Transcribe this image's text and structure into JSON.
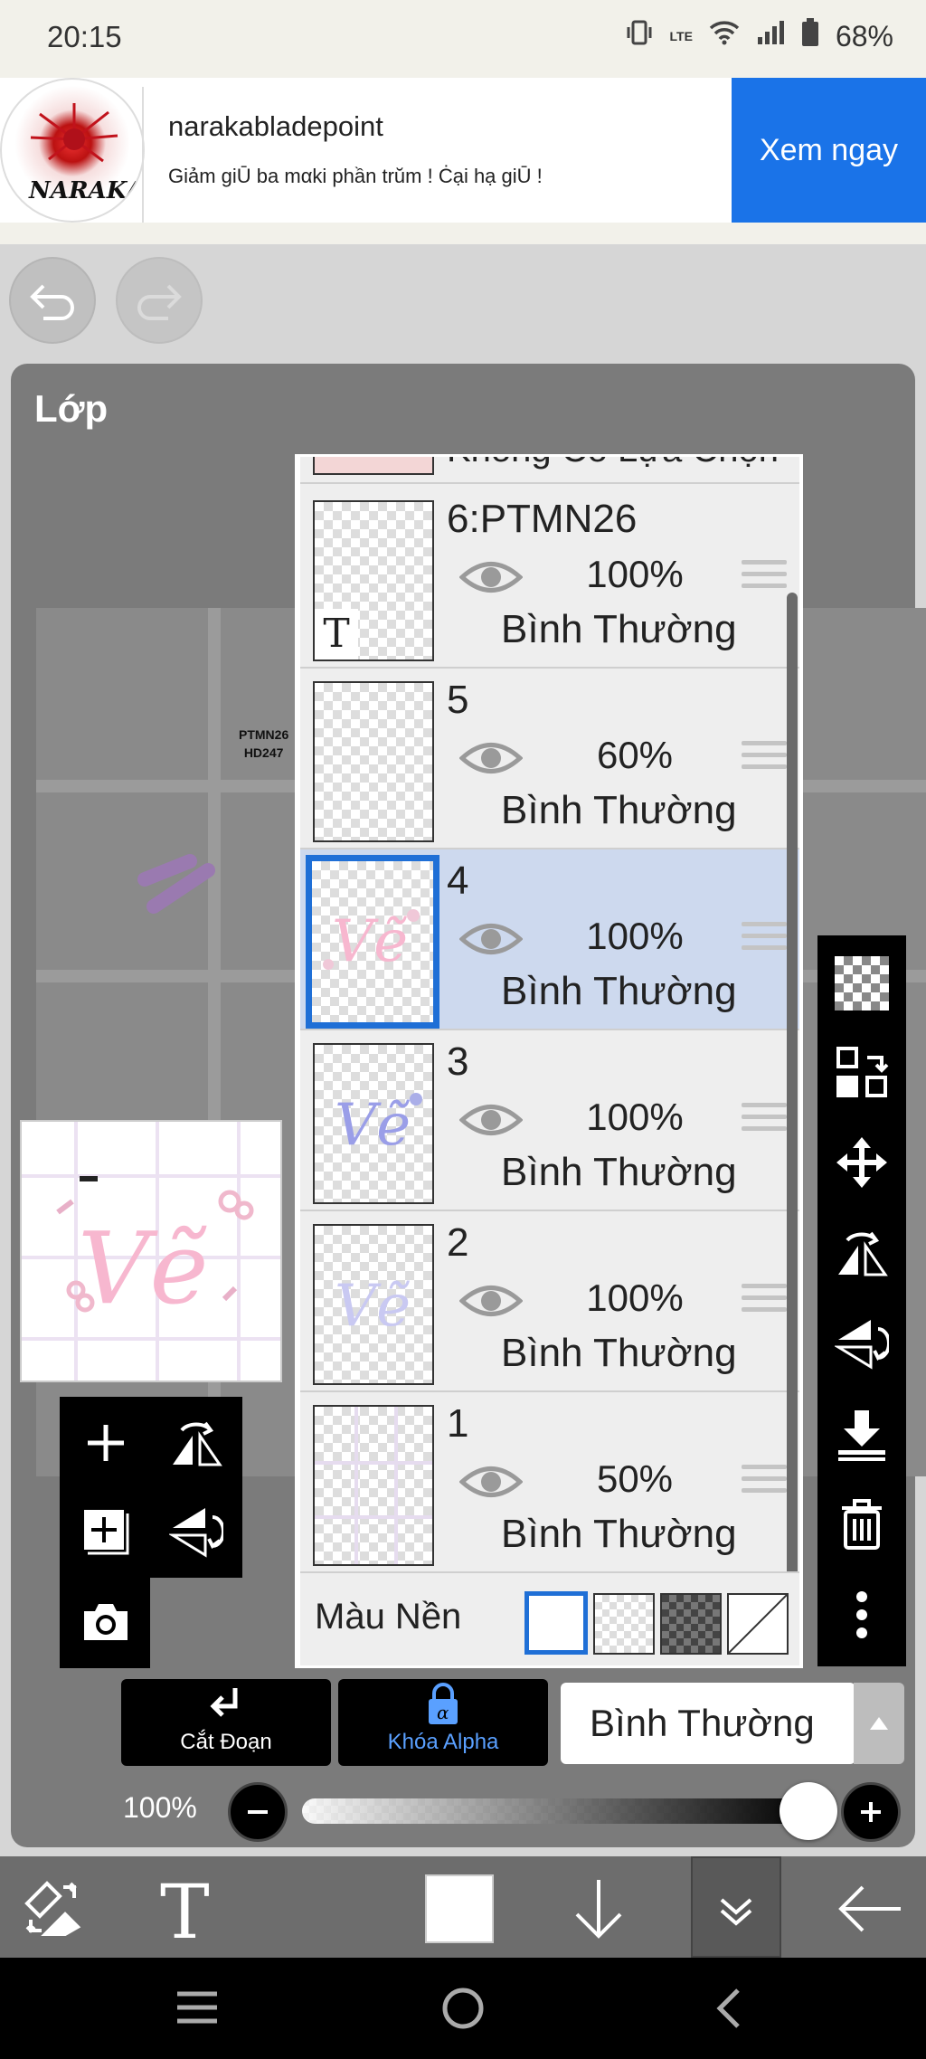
{
  "status_bar": {
    "time": "20:15",
    "network": "LTE",
    "battery": "68%"
  },
  "ad": {
    "logo_text": "NARAKA",
    "name": "narakabladepoint",
    "description": "Giảm giŪ ba mαki phần trŭm ! Ċại hạ giŪ !",
    "cta": "Xem ngay"
  },
  "panel": {
    "title": "Lớp"
  },
  "canvas": {
    "stamp_line1": "PTMN26",
    "stamp_line2": "HD247"
  },
  "layers": {
    "top_partial": "Không Có Lựa Chọn",
    "items": [
      {
        "name": "6:PTMN26",
        "opacity": "100%",
        "blend": "Bình Thường",
        "thumb_mark": "T"
      },
      {
        "name": "5",
        "opacity": "60%",
        "blend": "Bình Thường"
      },
      {
        "name": "4",
        "opacity": "100%",
        "blend": "Bình Thường",
        "selected": true
      },
      {
        "name": "3",
        "opacity": "100%",
        "blend": "Bình Thường"
      },
      {
        "name": "2",
        "opacity": "100%",
        "blend": "Bình Thường"
      },
      {
        "name": "1",
        "opacity": "50%",
        "blend": "Bình Thường"
      }
    ],
    "background_label": "Màu Nền"
  },
  "actions": {
    "cut_label": "Cắt Đoạn",
    "alpha_label": "Khóa Alpha",
    "blend_mode": "Bình Thường"
  },
  "opacity_control": {
    "label": "100%",
    "value": 1.0
  },
  "colors": {
    "accent": "#1f6fd6",
    "ad_button": "#1a73e8",
    "selected_row": "#cdd9ee",
    "alpha_text": "#5aa0ff"
  },
  "icons": {
    "right_toolbar": [
      "transparency-icon",
      "layer-swap-icon",
      "move-icon",
      "flip-horizontal-icon",
      "flip-vertical-icon",
      "merge-down-icon",
      "trash-icon",
      "more-icon"
    ],
    "bottom_toolbar": [
      "transform-icon",
      "text-tool-icon",
      "color-swatch-icon",
      "arrow-down-icon",
      "collapse-icon",
      "back-arrow-icon"
    ]
  }
}
